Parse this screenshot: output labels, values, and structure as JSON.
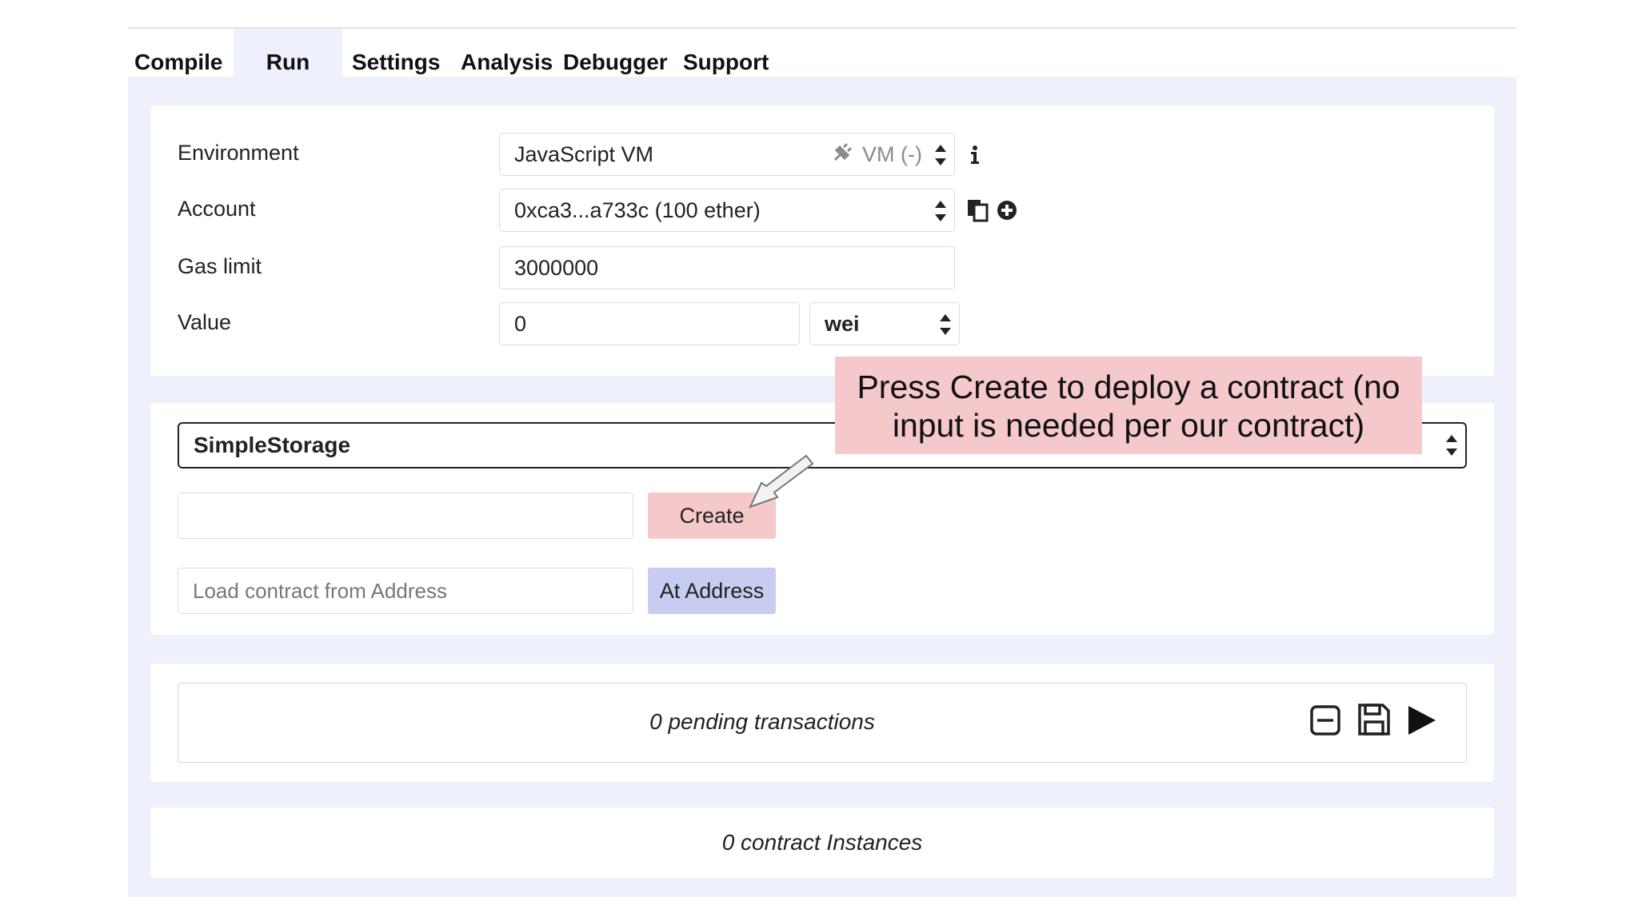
{
  "tabs": [
    {
      "label": "Compile",
      "active": false
    },
    {
      "label": "Run",
      "active": true
    },
    {
      "label": "Settings",
      "active": false
    },
    {
      "label": "Analysis",
      "active": false
    },
    {
      "label": "Debugger",
      "active": false
    },
    {
      "label": "Support",
      "active": false
    }
  ],
  "settings": {
    "environment": {
      "label": "Environment",
      "value": "JavaScriptVM",
      "display": "JavaScript VM",
      "vm_status": "VM (-)"
    },
    "account": {
      "label": "Account",
      "value": "0xca3...a733c (100 ether)"
    },
    "gas_limit": {
      "label": "Gas limit",
      "value": "3000000"
    },
    "value": {
      "label": "Value",
      "amount": "0",
      "unit": "wei"
    }
  },
  "contract": {
    "selected": "SimpleStorage",
    "create_input_value": "",
    "create_label": "Create",
    "address_placeholder": "Load contract from Address",
    "at_address_label": "At Address"
  },
  "transactions": {
    "pending_text": "0 pending transactions"
  },
  "instances": {
    "text": "0 contract Instances"
  },
  "callout": {
    "text": "Press Create to deploy a contract (no input is needed per our contract)"
  },
  "icons": {
    "info": "info-icon",
    "copy": "copy-icon",
    "add": "plus-circle-icon",
    "plug": "plug-icon",
    "collapse": "minus-square-icon",
    "save": "floppy-disk-icon",
    "play": "play-icon",
    "arrow": "arrow-pointer-icon"
  },
  "colors": {
    "panel_bg": "#eef0fb",
    "create_button": "#f5c9cc",
    "at_address_button": "#c7cdf0",
    "callout_bg": "#f5c9cc"
  }
}
